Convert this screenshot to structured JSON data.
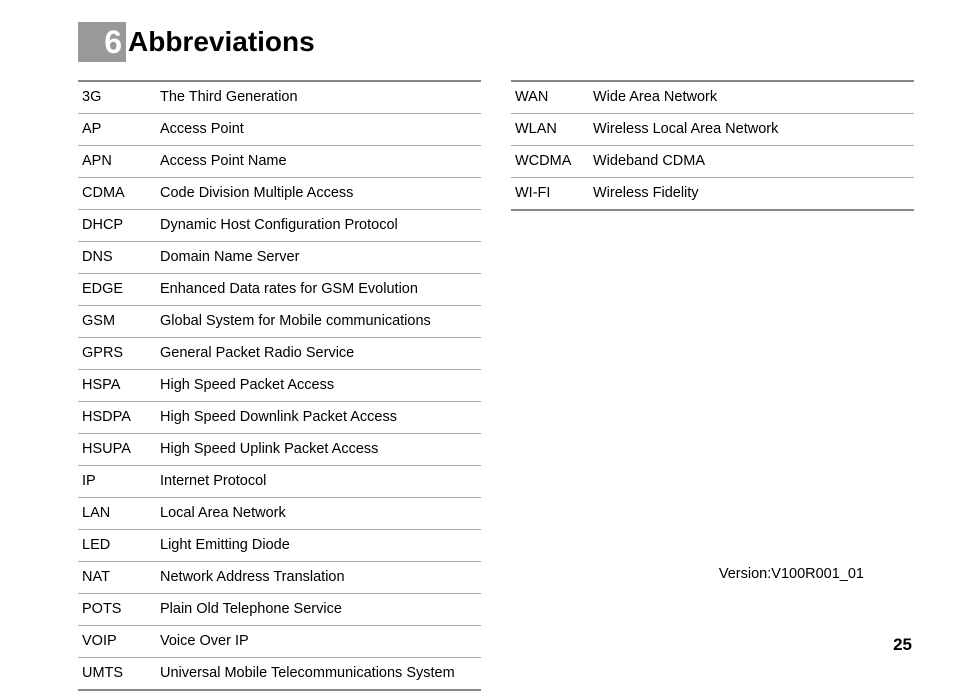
{
  "header": {
    "chapter_number": "6",
    "title": "Abbreviations"
  },
  "left_table": [
    {
      "abbr": "3G",
      "def": "The Third Generation"
    },
    {
      "abbr": "AP",
      "def": "Access Point"
    },
    {
      "abbr": "APN",
      "def": "Access Point Name"
    },
    {
      "abbr": "CDMA",
      "def": "Code Division Multiple Access"
    },
    {
      "abbr": "DHCP",
      "def": "Dynamic Host Configuration Protocol"
    },
    {
      "abbr": "DNS",
      "def": "Domain Name Server"
    },
    {
      "abbr": "EDGE",
      "def": "Enhanced Data rates for GSM Evolution"
    },
    {
      "abbr": "GSM",
      "def": "Global System for Mobile communications"
    },
    {
      "abbr": "GPRS",
      "def": "General Packet Radio Service"
    },
    {
      "abbr": "HSPA",
      "def": "High Speed Packet Access"
    },
    {
      "abbr": "HSDPA",
      "def": "High Speed Downlink Packet Access"
    },
    {
      "abbr": "HSUPA",
      "def": "High Speed Uplink Packet Access"
    },
    {
      "abbr": "IP",
      "def": "Internet Protocol"
    },
    {
      "abbr": "LAN",
      "def": "Local Area Network"
    },
    {
      "abbr": "LED",
      "def": "Light Emitting Diode"
    },
    {
      "abbr": "NAT",
      "def": "Network Address Translation"
    },
    {
      "abbr": "POTS",
      "def": "Plain Old Telephone Service"
    },
    {
      "abbr": "VOIP",
      "def": "Voice Over IP"
    },
    {
      "abbr": "UMTS",
      "def": "Universal Mobile Telecommunications System"
    }
  ],
  "right_table": [
    {
      "abbr": "WAN",
      "def": "Wide Area Network"
    },
    {
      "abbr": "WLAN",
      "def": "Wireless Local Area Network"
    },
    {
      "abbr": "WCDMA",
      "def": "Wideband CDMA"
    },
    {
      "abbr": "WI-FI",
      "def": "Wireless Fidelity"
    }
  ],
  "footer": {
    "version": "Version:V100R001_01",
    "page_number": "25"
  }
}
